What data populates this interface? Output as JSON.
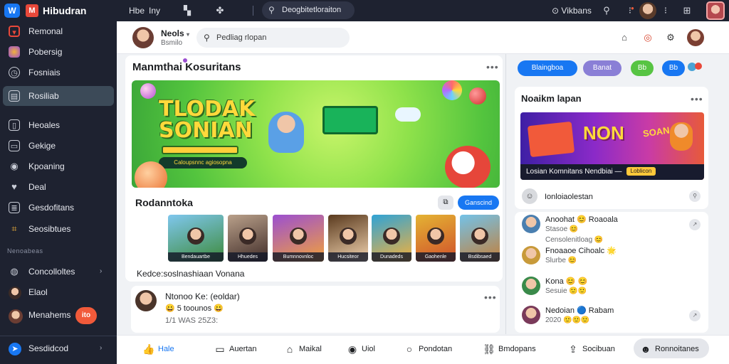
{
  "topbar": {
    "logo_badge": "W",
    "logo_mark": "M",
    "brand": "Hibudran",
    "text1": "Hbe",
    "text2": "Iny",
    "search_label": "Deogbitetloraiton",
    "right_label": "Vikbans"
  },
  "sidebar": {
    "items": [
      {
        "label": "Remonal",
        "icon": "shield-icon",
        "color": "#e8483a"
      },
      {
        "label": "Pobersig",
        "icon": "palette-icon",
        "color": "#f1b23a"
      },
      {
        "label": "Fosniais",
        "icon": "clock-icon",
        "color": "#c8ccd6"
      },
      {
        "label": "Rosiliab",
        "icon": "grid-icon",
        "color": "#c8ccd6"
      },
      {
        "label": "Heoales",
        "icon": "book-icon",
        "color": "#c8ccd6"
      },
      {
        "label": "Gekige",
        "icon": "chat-icon",
        "color": "#c8ccd6"
      },
      {
        "label": "Kpoaning",
        "icon": "record-icon",
        "color": "#c8ccd6"
      },
      {
        "label": "Deal",
        "icon": "heart-icon",
        "color": "#c8ccd6"
      },
      {
        "label": "Gesdofitans",
        "icon": "list-icon",
        "color": "#c8ccd6"
      },
      {
        "label": "Seosibtues",
        "icon": "tag-icon",
        "color": "#f1b23a"
      }
    ],
    "section_title": "Nenoabeas",
    "section_items": [
      {
        "label": "Concolloltes",
        "icon": "globe-icon"
      },
      {
        "label": "Elaol",
        "icon": "avatar"
      },
      {
        "label": "Menahems",
        "icon": "avatar",
        "badge": "ito"
      }
    ],
    "bottom_item": "Sesdidcod"
  },
  "header": {
    "name": "Neols",
    "sub": "Bsmilo",
    "search_placeholder": "Pedliag rlopan"
  },
  "feed": {
    "title": "Manmthai Kosuritans",
    "banner": {
      "title_line1": "TLODAK",
      "title_line2": "SONIAN",
      "pill": "Caloupsnnc agiosopna"
    },
    "recs": {
      "title": "Rodanntoka",
      "button": "Ganscind",
      "footer": "Kedce:soslnashiaan Vonana",
      "thumbs": [
        {
          "caption": "Bendauartbe",
          "colors": [
            "#7fc7ee",
            "#3d8a3a"
          ]
        },
        {
          "caption": "Hhuedes",
          "colors": [
            "#b9a08a",
            "#402c28"
          ]
        },
        {
          "caption": "Bumnnovnloc",
          "colors": [
            "#9b4fd1",
            "#f2a23a"
          ]
        },
        {
          "caption": "Hucsiteor",
          "colors": [
            "#5a3a1e",
            "#f2d4b0"
          ]
        },
        {
          "caption": "Dunadeds",
          "colors": [
            "#2fa3d6",
            "#f6b13a"
          ]
        },
        {
          "caption": "Gaohenle",
          "colors": [
            "#e4b333",
            "#d0502b"
          ]
        },
        {
          "caption": "Bsdibsaed",
          "colors": [
            "#73c2e8",
            "#c37f3a"
          ]
        }
      ]
    },
    "post": {
      "name": "Ntonoo Ke: (eoldar)",
      "line": "😀 5 toounos 😀",
      "date": "1/1 WAS 25Z3:"
    }
  },
  "right": {
    "pills": [
      {
        "label": "Blaingboa",
        "color": "#1877f2"
      },
      {
        "label": "Banat",
        "color": "#8a7fd6"
      },
      {
        "label": "Bb",
        "color": "#57c443"
      },
      {
        "label": "Bb",
        "color": "#1877f2"
      }
    ],
    "card_title": "Noaikm lapan",
    "banner_caption": "Losian Komnitans Nendbiai —",
    "banner_tag": "Loblicon",
    "banner_text1": "NON",
    "banner_text2": "SOAN",
    "list_header": "Ionloiaolestan",
    "rows": [
      {
        "name": "Anoohat 😊 Roaoala",
        "sub": "Stasoe 😊",
        "sub2": "Censolenitloag 😊"
      },
      {
        "name": "Fnoaaoe Cihoalc 🌟",
        "sub": "Slurbe 😊"
      },
      {
        "name": "Kona 😊 😊",
        "sub": "Sesuie 🙂🙂"
      },
      {
        "name": "Nedoian 🔵 Rabam",
        "sub": "2020 🙂🙂🙂"
      }
    ]
  },
  "bottom_nav": [
    {
      "label": "Hale",
      "icon": "thumb-up-icon",
      "active": true
    },
    {
      "label": "Auertan",
      "icon": "comment-icon"
    },
    {
      "label": "Maikal",
      "icon": "share-icon"
    },
    {
      "label": "Uiol",
      "icon": "camera-icon"
    },
    {
      "label": "Pondotan",
      "icon": "chat-icon"
    },
    {
      "label": "Bmdopans",
      "icon": "link-icon"
    },
    {
      "label": "Socibuan",
      "icon": "upload-icon"
    },
    {
      "label": "Ronnoitanes",
      "icon": "user-icon"
    }
  ]
}
